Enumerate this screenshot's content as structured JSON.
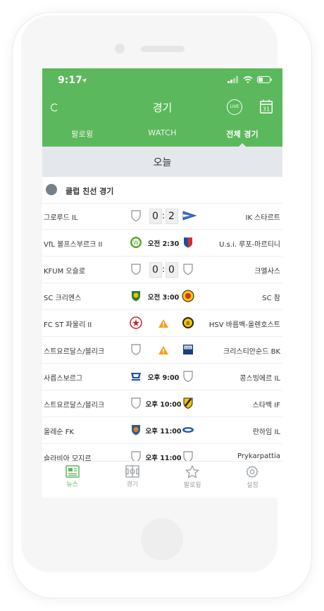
{
  "status_bar": {
    "time": "9:17"
  },
  "header": {
    "title": "경기",
    "live_label": "LIVE",
    "calendar_day": "31",
    "accent_color": "#5cb85c"
  },
  "tabs": [
    {
      "label": "팔로윙",
      "active": false
    },
    {
      "label": "WATCH",
      "active": false
    },
    {
      "label": "전체 경기",
      "active": true
    }
  ],
  "date_label": "오늘",
  "section": {
    "title": "클럽 친선 경기",
    "icon": "club-friendly-icon"
  },
  "matches": [
    {
      "home": "그로루드 IL",
      "away": "IK 스타르트",
      "home_score": "0",
      "away_score": "2",
      "time": "",
      "home_crest": "shield-outline",
      "away_crest": "pennant-blue",
      "warning": false
    },
    {
      "home": "VfL 볼프스부르크 II",
      "away": "U.s.i. 루포-마르티니",
      "home_score": "",
      "away_score": "",
      "time": "오전 2:30",
      "home_crest": "wolfsburg-green",
      "away_crest": "blue-red-shield",
      "warning": false
    },
    {
      "home": "KFUM 오슬로",
      "away": "크엘사스",
      "home_score": "0",
      "away_score": "0",
      "time": "",
      "home_crest": "shield-outline",
      "away_crest": "shield-outline",
      "warning": false
    },
    {
      "home": "SC 크리엔스",
      "away": "SC 참",
      "home_score": "",
      "away_score": "",
      "time": "오전 3:00",
      "home_crest": "green-yellow-shield",
      "away_crest": "yellow-round",
      "warning": false
    },
    {
      "home": "FC ST 파울리 II",
      "away": "HSV 바름벡-올렌호스트",
      "home_score": "",
      "away_score": "",
      "time": "",
      "home_crest": "red-round",
      "away_crest": "yellow-black-round",
      "warning": true
    },
    {
      "home": "스트요르달스/블리크",
      "away": "크리스티안순드 BK",
      "home_score": "",
      "away_score": "",
      "time": "",
      "home_crest": "shield-outline",
      "away_crest": "kbk-blue",
      "warning": true
    },
    {
      "home": "사릅스보르그",
      "away": "콩스빙에르 IL",
      "home_score": "",
      "away_score": "",
      "time": "오후 9:00",
      "home_crest": "blue-white",
      "away_crest": "shield-outline",
      "warning": false
    },
    {
      "home": "스트요르달스/블리크",
      "away": "스타백 IF",
      "home_score": "",
      "away_score": "",
      "time": "오후 10:00",
      "home_crest": "shield-outline",
      "away_crest": "black-yellow-shield",
      "warning": false
    },
    {
      "home": "올레순 FK",
      "away": "란하임 IL",
      "home_score": "",
      "away_score": "",
      "time": "오후 11:00",
      "home_crest": "blue-orange-shield",
      "away_crest": "blue-oval",
      "warning": false
    },
    {
      "home": "슬라비아 모지르",
      "away": "Prykarpattia",
      "home_score": "",
      "away_score": "",
      "time": "오후 11:00",
      "home_crest": "shield-outline",
      "away_crest": "shield-outline",
      "warning": false
    }
  ],
  "bottom_nav": [
    {
      "label": "뉴스",
      "icon": "news-icon",
      "active": true
    },
    {
      "label": "경기",
      "icon": "pitch-icon",
      "active": false
    },
    {
      "label": "팔로윙",
      "icon": "star-icon",
      "active": false
    },
    {
      "label": "설정",
      "icon": "gear-icon",
      "active": false
    }
  ]
}
